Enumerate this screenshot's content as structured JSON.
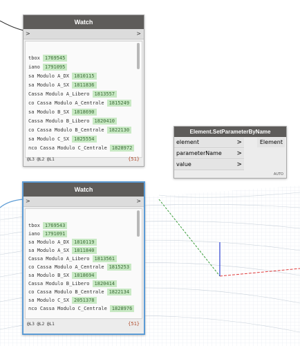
{
  "watch1": {
    "title": "Watch",
    "port_in": ">",
    "port_out": ">",
    "items": [
      {
        "label": "tbox",
        "value": "1769545"
      },
      {
        "label": "iano",
        "value": "1791095"
      },
      {
        "label": "sa Modulo A_DX",
        "value": "1810115"
      },
      {
        "label": "sa Modulo A_SX",
        "value": "1811836"
      },
      {
        "label": " Cassa Modulo A_Libero",
        "value": "1813557"
      },
      {
        "label": "co Cassa Modulo A_Centrale",
        "value": "1815249"
      },
      {
        "label": "sa Modulo B_SX",
        "value": "1818690"
      },
      {
        "label": " Cassa Modulo B_Libero",
        "value": "1820410"
      },
      {
        "label": "co Cassa Modulo B_Centrale",
        "value": "1822130"
      },
      {
        "label": "sa Modulo C_SX",
        "value": "1825554"
      },
      {
        "label": "nco Cassa Modulo C_Centrale",
        "value": "1828972"
      }
    ],
    "levels": "@L3 @L2 @L1",
    "count": "{51}"
  },
  "watch2": {
    "title": "Watch",
    "port_in": ">",
    "port_out": ">",
    "items": [
      {
        "label": "tbox",
        "value": "1769543"
      },
      {
        "label": "iano",
        "value": "1791091"
      },
      {
        "label": "sa Modulo A_DX",
        "value": "1810119"
      },
      {
        "label": "sa Modulo A_SX",
        "value": "1811840"
      },
      {
        "label": " Cassa Modulo A_Libero",
        "value": "1813561"
      },
      {
        "label": "co Cassa Modulo A_Centrale",
        "value": "1815253"
      },
      {
        "label": "sa Modulo B_SX",
        "value": "1818694"
      },
      {
        "label": " Cassa Modulo B_Libero",
        "value": "1820414"
      },
      {
        "label": "co Cassa Modulo B_Centrale",
        "value": "1822134"
      },
      {
        "label": "sa Modulo C_SX",
        "value": "2051378"
      },
      {
        "label": "nco Cassa Modulo C_Centrale",
        "value": "1828976"
      }
    ],
    "levels": "@L3 @L2 @L1",
    "count": "{51}"
  },
  "setparam": {
    "title": "Element.SetParameterByName",
    "inputs": [
      "element",
      "parameterName",
      "value"
    ],
    "output": "Element",
    "lacing": "AUTO",
    "arrow": ">"
  },
  "colors": {
    "node_title": "#5e5c5a",
    "value_chip": "#c8e9c4",
    "selected_border": "#5b9bd5",
    "axis_x": "#e03b3b",
    "axis_y": "#3a9c3a",
    "axis_z": "#2b3fd0"
  }
}
